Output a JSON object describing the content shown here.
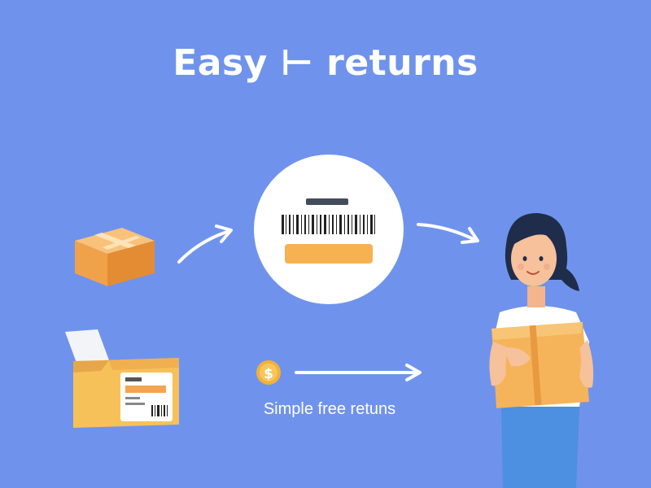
{
  "header": {
    "title": "Easy ⊢ returns"
  },
  "flow": {
    "caption": "Simple free retuns"
  },
  "colors": {
    "background": "#6f93ec",
    "box_orange": "#f4a44a",
    "box_yellow": "#f7c15a",
    "white": "#ffffff",
    "coin": "#f2b13a"
  },
  "icons": [
    "box-icon",
    "open-box-icon",
    "label-scan-icon",
    "dollar-coin-icon",
    "arrow-icon",
    "person-holding-box-illustration"
  ]
}
